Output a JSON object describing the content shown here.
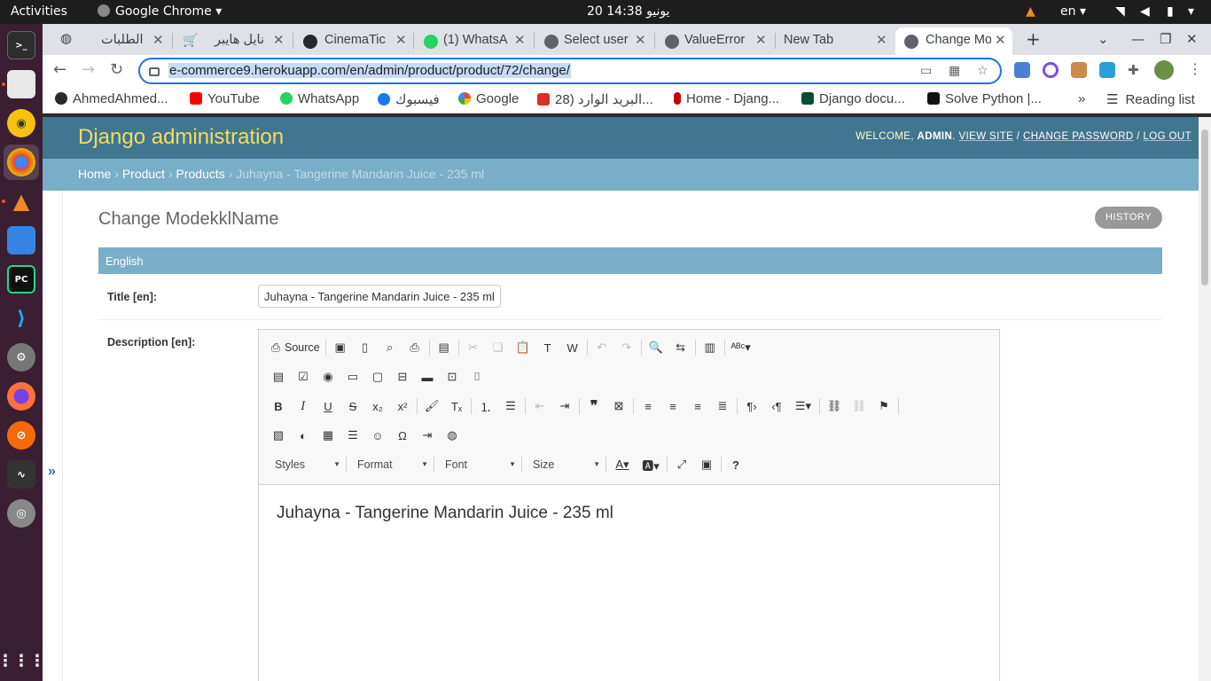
{
  "topbar": {
    "activities": "Activities",
    "app_name": "Google Chrome",
    "clock": "20 يونيو  14:38",
    "lang": "en"
  },
  "dock": {
    "items": [
      "terminal-icon",
      "files-icon",
      "rhythmbox-icon",
      "chrome-icon",
      "vlc-icon",
      "screenshot-icon",
      "pycharm-icon",
      "vscode-icon",
      "settings-icon",
      "firefox-icon",
      "safari-like-icon",
      "system-monitor-icon",
      "disk-icon",
      "app-grid-icon"
    ]
  },
  "browser": {
    "tabs": [
      {
        "title": "الطلبات",
        "icon": "globe-icon"
      },
      {
        "title": "نايل هايبر",
        "icon": "cart-icon"
      },
      {
        "title": "CinemaTic",
        "icon": "github-icon"
      },
      {
        "title": "(1) WhatsA",
        "icon": "whatsapp-icon"
      },
      {
        "title": "Select user",
        "icon": "globe-icon"
      },
      {
        "title": "ValueError",
        "icon": "globe-icon"
      },
      {
        "title": "New Tab",
        "icon": "none"
      },
      {
        "title": "Change Mo",
        "icon": "globe-icon"
      }
    ],
    "url": "e-commerce9.herokuapp.com/en/admin/product/product/72/change/",
    "bookmarks": [
      {
        "label": "AhmedAhmed...",
        "icon": "github-icon",
        "color": "#24292e"
      },
      {
        "label": "YouTube",
        "icon": "youtube-icon",
        "color": "#ff0000"
      },
      {
        "label": "WhatsApp",
        "icon": "whatsapp-icon",
        "color": "#25d366"
      },
      {
        "label": "فيسبوك",
        "icon": "facebook-icon",
        "color": "#1877f2"
      },
      {
        "label": "Google",
        "icon": "google-icon",
        "color": "#4285f4"
      },
      {
        "label": "البريد الوارد (28...",
        "icon": "gmail-icon",
        "color": "#d93025"
      },
      {
        "label": "Home - Djang...",
        "icon": "django-icon",
        "color": "#c00"
      },
      {
        "label": "Django docu...",
        "icon": "dj-icon",
        "color": "#0c4b33"
      },
      {
        "label": "Solve Python |...",
        "icon": "hackerrank-icon",
        "color": "#111"
      }
    ],
    "reading_list": "Reading list"
  },
  "admin": {
    "site_name": "Django administration",
    "welcome": "WELCOME, ",
    "user": "ADMIN",
    "view_site": "VIEW SITE",
    "change_password": "CHANGE PASSWORD",
    "log_out": "LOG OUT",
    "breadcrumbs": {
      "home": "Home",
      "product": "Product",
      "products": "Products",
      "current": "Juhayna - Tangerine Mandarin Juice - 235 ml",
      "sep": " › "
    },
    "page_title": "Change ModekklName",
    "history": "HISTORY",
    "fieldset": "English",
    "title_label": "Title [en]:",
    "title_value": "Juhayna - Tangerine Mandarin Juice - 235 ml",
    "description_label": "Description [en]:",
    "sidebar_toggle": "»"
  },
  "editor": {
    "source_label": "Source",
    "styles_label": "Styles",
    "format_label": "Format",
    "font_label": "Font",
    "size_label": "Size",
    "content": "Juhayna - Tangerine Mandarin Juice - 235 ml"
  },
  "colors": {
    "django_header": "#417690",
    "django_breadcrumbs": "#79aec8",
    "site_name": "#f5dd5d"
  }
}
